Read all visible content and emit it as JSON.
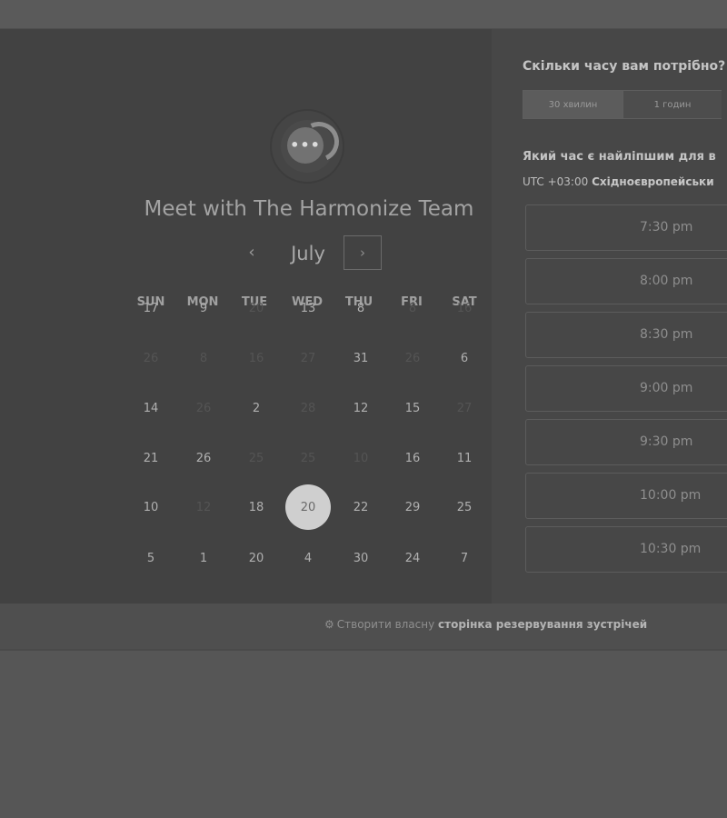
{
  "booking": {
    "title": "Meet with The Harmonize Team",
    "month": "July",
    "prev_icon": "‹",
    "next_icon": "›",
    "weekdays": [
      "SUN",
      "MON",
      "TUE",
      "WED",
      "THU",
      "FRI",
      "SAT"
    ],
    "weeks": [
      [
        {
          "d": "17",
          "on": true
        },
        {
          "d": "9",
          "on": true
        },
        {
          "d": "20",
          "on": false
        },
        {
          "d": "13",
          "on": true
        },
        {
          "d": "8",
          "on": true
        },
        {
          "d": "8",
          "on": false
        },
        {
          "d": "16",
          "on": false
        }
      ],
      [
        {
          "d": "26",
          "on": false
        },
        {
          "d": "8",
          "on": false
        },
        {
          "d": "16",
          "on": false
        },
        {
          "d": "27",
          "on": false
        },
        {
          "d": "31",
          "on": true
        },
        {
          "d": "26",
          "on": false
        },
        {
          "d": "6",
          "on": true
        }
      ],
      [
        {
          "d": "14",
          "on": true
        },
        {
          "d": "26",
          "on": false
        },
        {
          "d": "2",
          "on": true
        },
        {
          "d": "28",
          "on": false
        },
        {
          "d": "12",
          "on": true
        },
        {
          "d": "15",
          "on": true
        },
        {
          "d": "27",
          "on": false
        }
      ],
      [
        {
          "d": "21",
          "on": true
        },
        {
          "d": "26",
          "on": true
        },
        {
          "d": "25",
          "on": false
        },
        {
          "d": "25",
          "on": false
        },
        {
          "d": "10",
          "on": false
        },
        {
          "d": "16",
          "on": true
        },
        {
          "d": "11",
          "on": true
        }
      ],
      [
        {
          "d": "10",
          "on": true
        },
        {
          "d": "12",
          "on": false
        },
        {
          "d": "18",
          "on": true
        },
        {
          "d": "20",
          "on": true,
          "selected": true
        },
        {
          "d": "22",
          "on": true
        },
        {
          "d": "29",
          "on": true
        },
        {
          "d": "25",
          "on": true
        }
      ],
      [
        {
          "d": "5",
          "on": true
        },
        {
          "d": "1",
          "on": true
        },
        {
          "d": "20",
          "on": true
        },
        {
          "d": "4",
          "on": true
        },
        {
          "d": "30",
          "on": true
        },
        {
          "d": "24",
          "on": true
        },
        {
          "d": "7",
          "on": true
        }
      ]
    ]
  },
  "scheduler": {
    "duration_question": "Скільки часу вам потрібно?",
    "durations": [
      "30 хвилин",
      "1 годин"
    ],
    "time_question": "Який час є найліпшим для в",
    "timezone_prefix": "UTC +03:00",
    "timezone_name": "Східноєвропейськи",
    "slots": [
      "7:30 pm",
      "8:00 pm",
      "8:30 pm",
      "9:00 pm",
      "9:30 pm",
      "10:00 pm",
      "10:30 pm"
    ]
  },
  "footer": {
    "text": "Створити власну",
    "link": "сторінка резервування зустрічей"
  },
  "colors": {
    "left_panel": "#424242",
    "right_panel": "#474747",
    "selected_day": "#cfcfcf"
  },
  "icons": {
    "avatar": "chat-bubble-icon",
    "footer": "hubspot-sprocket-icon"
  }
}
